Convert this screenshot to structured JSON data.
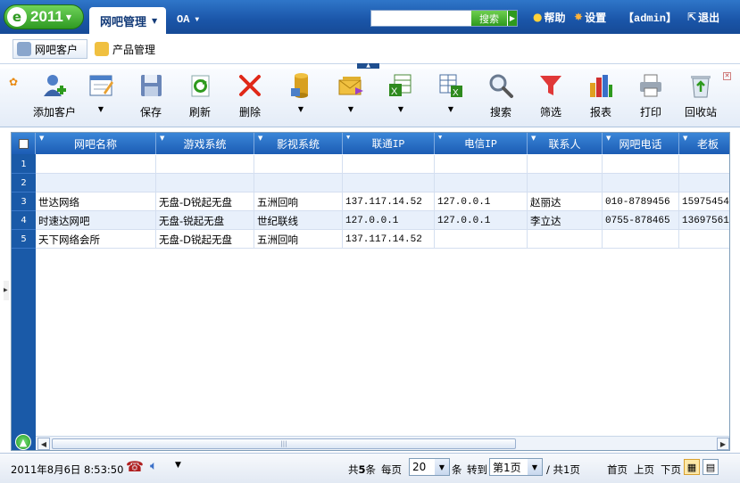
{
  "logo": {
    "text": "2011"
  },
  "top_nav": {
    "active_tab": "网吧管理",
    "oa_tab": "OA",
    "search_placeholder": "",
    "search_button": "搜索",
    "help": "帮助",
    "settings": "设置",
    "user": "【admin】",
    "logout": "退出"
  },
  "sub_tabs": [
    {
      "label": "网吧客户"
    },
    {
      "label": "产品管理"
    }
  ],
  "toolbar": {
    "add_customer": "添加客户",
    "save": "保存",
    "refresh": "刷新",
    "delete": "删除",
    "search": "搜索",
    "filter": "筛选",
    "report": "报表",
    "print": "打印",
    "recycle_bin": "回收站"
  },
  "grid": {
    "columns": [
      "网吧名称",
      "游戏系统",
      "影视系统",
      "联通IP",
      "电信IP",
      "联系人",
      "网吧电话",
      "老板"
    ],
    "rows": [
      {
        "num": "1",
        "cells": [
          "",
          "",
          "",
          "",
          "",
          "",
          "",
          ""
        ]
      },
      {
        "num": "2",
        "cells": [
          "",
          "",
          "",
          "",
          "",
          "",
          "",
          ""
        ]
      },
      {
        "num": "3",
        "cells": [
          "世达网络",
          "无盘-D锐起无盘",
          "五洲回响",
          "137.117.14.52",
          "127.0.0.1",
          "赵丽达",
          "010-8789456",
          "15975454"
        ]
      },
      {
        "num": "4",
        "cells": [
          "时速达网吧",
          "无盘-锐起无盘",
          "世纪联线",
          "127.0.0.1",
          "127.0.0.1",
          "李立达",
          "0755-878465",
          "13697561"
        ]
      },
      {
        "num": "5",
        "cells": [
          "天下网络会所",
          "无盘-D锐起无盘",
          "五洲回响",
          "137.117.14.52",
          "",
          "",
          "",
          ""
        ]
      }
    ]
  },
  "status": {
    "datetime": "2011年8月6日 8:53:50",
    "total_prefix": "共",
    "total_count": "5",
    "total_suffix": "条",
    "per_page_label": "每页",
    "per_page_value": "20",
    "per_page_unit": "条",
    "goto_label": "转到",
    "page_value": "第1页",
    "total_pages": "/ 共1页",
    "first": "首页",
    "prev": "上页",
    "next": "下页"
  },
  "colors": {
    "header_blue": "#1a55a8",
    "grid_header": "#2a72c8",
    "accent_green": "#2e9a1e"
  }
}
